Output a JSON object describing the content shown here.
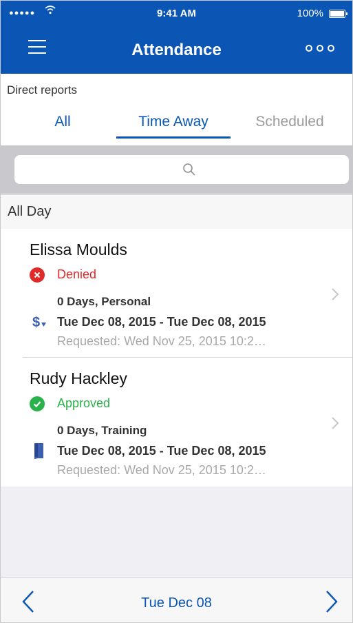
{
  "status_bar": {
    "signal": "●●●●●",
    "time": "9:41 AM",
    "battery": "100%"
  },
  "nav": {
    "title": "Attendance",
    "menu_icon": "hamburger-menu-icon",
    "more_icon": "more-options-icon"
  },
  "filter": {
    "label": "Direct reports",
    "tabs": [
      "All",
      "Time Away",
      "Scheduled"
    ],
    "selected_tab": "Time Away"
  },
  "search": {
    "placeholder": ""
  },
  "section": {
    "title": "All Day"
  },
  "entries": [
    {
      "name": "Elissa Moulds",
      "status": "Denied",
      "status_color": "#e02a2a",
      "days": "0 Days, Personal",
      "date_range": "Tue Dec 08, 2015 - Tue Dec 08, 2015",
      "requested": "Requested: Wed Nov 25, 2015 10:2…",
      "type_icon": "dollar-icon"
    },
    {
      "name": "Rudy Hackley",
      "status": "Approved",
      "status_color": "#2ab24a",
      "days": "0 Days, Training",
      "date_range": "Tue Dec 08, 2015 - Tue Dec 08, 2015",
      "requested": "Requested: Wed Nov 25, 2015 10:2…",
      "type_icon": "book-icon"
    }
  ],
  "footer": {
    "date": "Tue Dec 08"
  },
  "colors": {
    "brand": "#0b56b4",
    "denied": "#e02a2a",
    "approved": "#2ab24a"
  }
}
